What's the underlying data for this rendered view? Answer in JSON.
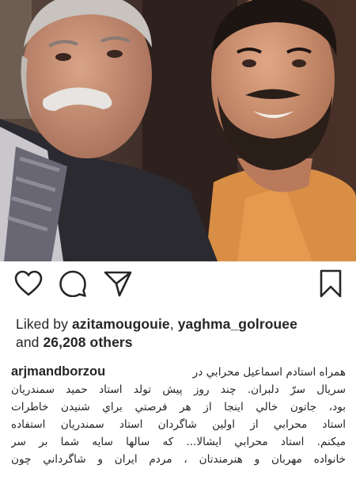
{
  "post": {
    "photo_alt": "selfie",
    "actions": {
      "like_icon": "heart-outline-icon",
      "comment_icon": "comment-bubble-icon",
      "share_icon": "paper-plane-icon",
      "save_icon": "bookmark-outline-icon"
    },
    "likes": {
      "prefix": "Liked by ",
      "user1": "azitamougouie",
      "separator": ", ",
      "user2": "yaghma_golrouee",
      "and": "and ",
      "count": "26,208 others"
    },
    "caption": {
      "username": "arjmandborzou",
      "lines": [
        "همراه استادم اسماعیل محرابي در",
        "سريال سرّ دلبران. چند روز پیش تولد استاد حمید سمندريان",
        "بود، جاتون خالي اينجا از هر فرصتي براي شنیدن خاطرات",
        "استاد محرابي از اولين شاگردان استاد سمندريان استفاده",
        "میکنم. استاد محرابي ايشالا... كه سالها سايه شما بر سر",
        "خانواده مهربان و هنرمندتان ، مردم ايران و شاگرداني چون"
      ]
    },
    "colors": {
      "text": "#262626",
      "background": "#ffffff"
    }
  }
}
